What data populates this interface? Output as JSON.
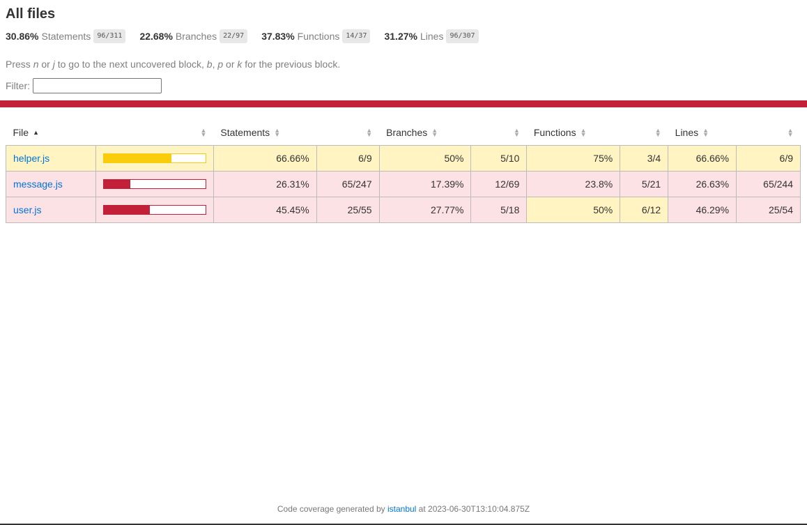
{
  "title": "All files",
  "summary": [
    {
      "pct": "30.86%",
      "label": "Statements",
      "fraction": "96/311"
    },
    {
      "pct": "22.68%",
      "label": "Branches",
      "fraction": "22/97"
    },
    {
      "pct": "37.83%",
      "label": "Functions",
      "fraction": "14/37"
    },
    {
      "pct": "31.27%",
      "label": "Lines",
      "fraction": "96/307"
    }
  ],
  "help": {
    "t1": "Press ",
    "k1": "n",
    "t2": " or ",
    "k2": "j",
    "t3": " to go to the next uncovered block, ",
    "k3": "b",
    "t4": ", ",
    "k4": "p",
    "t5": " or ",
    "k5": "k",
    "t6": " for the previous block."
  },
  "filter": {
    "label": "Filter:",
    "value": ""
  },
  "table": {
    "headers": {
      "file": "File",
      "statements": "Statements",
      "branches": "Branches",
      "functions": "Functions",
      "lines": "Lines"
    },
    "rows": [
      {
        "file": "helper.js",
        "level": "medium",
        "bar_fraction": 0.6666,
        "stmt_pct": "66.66%",
        "stmt_frac": "6/9",
        "branch_pct": "50%",
        "branch_frac": "5/10",
        "func_pct": "75%",
        "func_frac": "3/4",
        "lines_pct": "66.66%",
        "lines_frac": "6/9"
      },
      {
        "file": "message.js",
        "level": "low",
        "bar_fraction": 0.2631,
        "stmt_pct": "26.31%",
        "stmt_frac": "65/247",
        "branch_pct": "17.39%",
        "branch_frac": "12/69",
        "func_pct": "23.8%",
        "func_frac": "5/21",
        "lines_pct": "26.63%",
        "lines_frac": "65/244"
      },
      {
        "file": "user.js",
        "level": "low",
        "bar_fraction": 0.4545,
        "stmt_pct": "45.45%",
        "stmt_frac": "25/55",
        "branch_pct": "27.77%",
        "branch_frac": "5/18",
        "func_pct": "50%",
        "func_frac": "6/12",
        "func_level": "medium",
        "lines_pct": "46.29%",
        "lines_frac": "25/54"
      }
    ]
  },
  "footer": {
    "prefix": "Code coverage generated by ",
    "link": "istanbul",
    "suffix": " at 2023-06-30T13:10:04.875Z"
  },
  "colors": {
    "low": "#c21f39",
    "medium": "#f9cd0b",
    "link": "#0074d9"
  },
  "icons": {
    "sort_asc": "caret-up-icon",
    "sort_both": "sort-icon"
  }
}
